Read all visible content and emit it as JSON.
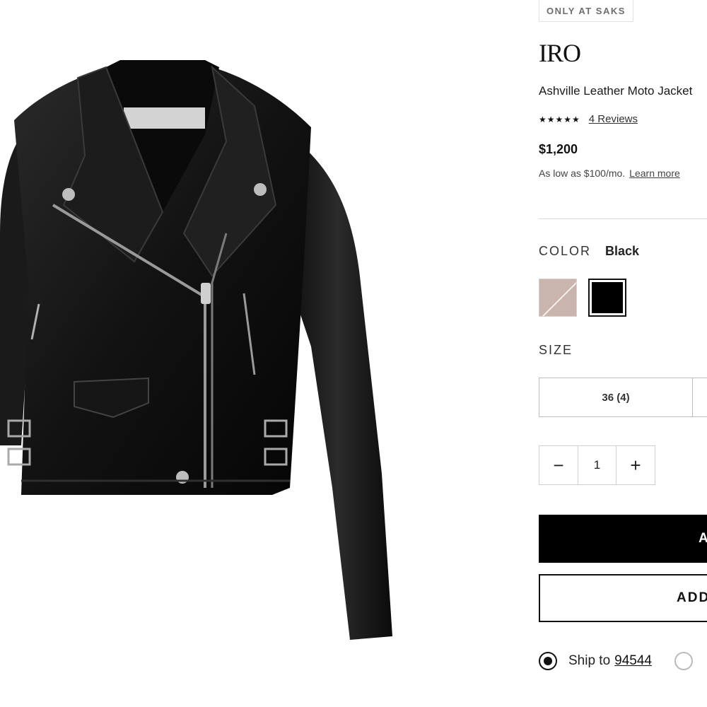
{
  "badge": {
    "label": "ONLY AT SAKS"
  },
  "product": {
    "brand": "IRO",
    "name": "Ashville Leather Moto Jacket",
    "rating_stars": "★★★★★",
    "reviews_label": "4 Reviews",
    "price": "$1,200",
    "financing_text": "As low as $100/mo.",
    "financing_link": "Learn more"
  },
  "color": {
    "label": "COLOR",
    "selected": "Black",
    "swatches": [
      {
        "name": "taupe",
        "hex": "#c9b5ae"
      },
      {
        "name": "black",
        "hex": "#000000",
        "selected": true
      }
    ]
  },
  "size": {
    "label": "SIZE",
    "options": [
      "36 (4)"
    ]
  },
  "quantity": {
    "minus": "−",
    "value": "1",
    "plus": "+"
  },
  "actions": {
    "primary_label": "ADD TO BAG",
    "secondary_label": "ADD TO WISH LIST"
  },
  "shipping": {
    "ship_label": "Ship to",
    "zip": "94544"
  },
  "icons": {
    "product_image": "black-leather-moto-jacket-image"
  }
}
